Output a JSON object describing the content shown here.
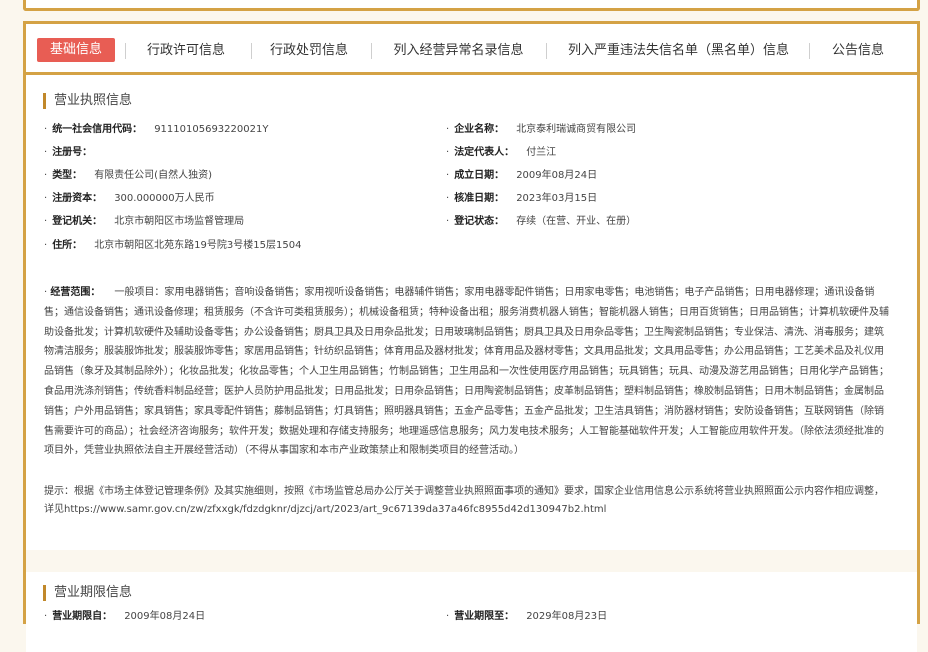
{
  "tabs": [
    {
      "label": "基础信息",
      "active": true
    },
    {
      "label": "行政许可信息",
      "active": false
    },
    {
      "label": "行政处罚信息",
      "active": false
    },
    {
      "label": "列入经营异常名录信息",
      "active": false
    },
    {
      "label": "列入严重违法失信名单（黑名单）信息",
      "active": false
    },
    {
      "label": "公告信息",
      "active": false
    }
  ],
  "license": {
    "title": "营业执照信息",
    "fields": {
      "credit_code": {
        "label": "统一社会信用代码：",
        "value": "91110105693220021Y"
      },
      "company_name": {
        "label": "企业名称：",
        "value": "北京泰利瑞诚商贸有限公司"
      },
      "reg_number": {
        "label": "注册号：",
        "value": ""
      },
      "legal_rep": {
        "label": "法定代表人：",
        "value": "付兰江"
      },
      "type": {
        "label": "类型：",
        "value": "有限责任公司(自然人独资)"
      },
      "established": {
        "label": "成立日期：",
        "value": "2009年08月24日"
      },
      "capital": {
        "label": "注册资本：",
        "value": "300.000000万人民币"
      },
      "approved": {
        "label": "核准日期：",
        "value": "2023年03月15日"
      },
      "authority": {
        "label": "登记机关：",
        "value": "北京市朝阳区市场监督管理局"
      },
      "status": {
        "label": "登记状态：",
        "value": "存续（在营、开业、在册）"
      },
      "address": {
        "label": "住所：",
        "value": "北京市朝阳区北苑东路19号院3号楼15层1504"
      }
    },
    "scope_label": "经营范围：",
    "scope_text": "一般项目：家用电器销售；音响设备销售；家用视听设备销售；电器辅件销售；家用电器零配件销售；日用家电零售；电池销售；电子产品销售；日用电器修理；通讯设备销售；通信设备销售；通讯设备修理；租赁服务（不含许可类租赁服务）；机械设备租赁；特种设备出租；服务消费机器人销售；智能机器人销售；日用百货销售；日用品销售；计算机软硬件及辅助设备批发；计算机软硬件及辅助设备零售；办公设备销售；厨具卫具及日用杂品批发；日用玻璃制品销售；厨具卫具及日用杂品零售；卫生陶瓷制品销售；专业保洁、清洗、消毒服务；建筑物清洁服务；服装服饰批发；服装服饰零售；家居用品销售；针纺织品销售；体育用品及器材批发；体育用品及器材零售；文具用品批发；文具用品零售；办公用品销售；工艺美术品及礼仪用品销售（象牙及其制品除外）；化妆品批发；化妆品零售；个人卫生用品销售；竹制品销售；卫生用品和一次性使用医疗用品销售；玩具销售；玩具、动漫及游艺用品销售；日用化学产品销售；食品用洗涤剂销售；传统香料制品经营；医护人员防护用品批发；日用品批发；日用杂品销售；日用陶瓷制品销售；皮革制品销售；塑料制品销售；橡胶制品销售；日用木制品销售；金属制品销售；户外用品销售；家具销售；家具零配件销售；藤制品销售；灯具销售；照明器具销售；五金产品零售；五金产品批发；卫生洁具销售；消防器材销售；安防设备销售；互联网销售（除销售需要许可的商品）；社会经济咨询服务；软件开发；数据处理和存储支持服务；地理遥感信息服务；风力发电技术服务；人工智能基础软件开发；人工智能应用软件开发。（除依法须经批准的项目外，凭营业执照依法自主开展经营活动）（不得从事国家和本市产业政策禁止和限制类项目的经营活动。）",
    "note": "提示：根据《市场主体登记管理条例》及其实施细则，按照《市场监管总局办公厅关于调整营业执照照面事项的通知》要求，国家企业信用信息公示系统将营业执照照面公示内容作相应调整，详见https://www.samr.gov.cn/zw/zfxxgk/fdzdgknr/djzcj/art/2023/art_9c67139da37a46fc8955d42d130947b2.html"
  },
  "period": {
    "title": "营业期限信息",
    "from_label": "营业期限自：",
    "from_value": "2009年08月24日",
    "to_label": "营业期限至：",
    "to_value": "2029年08月23日"
  },
  "colors": {
    "accent": "#d4a245",
    "active_tab": "#e85d54",
    "page_bg": "#fbf7ee"
  }
}
